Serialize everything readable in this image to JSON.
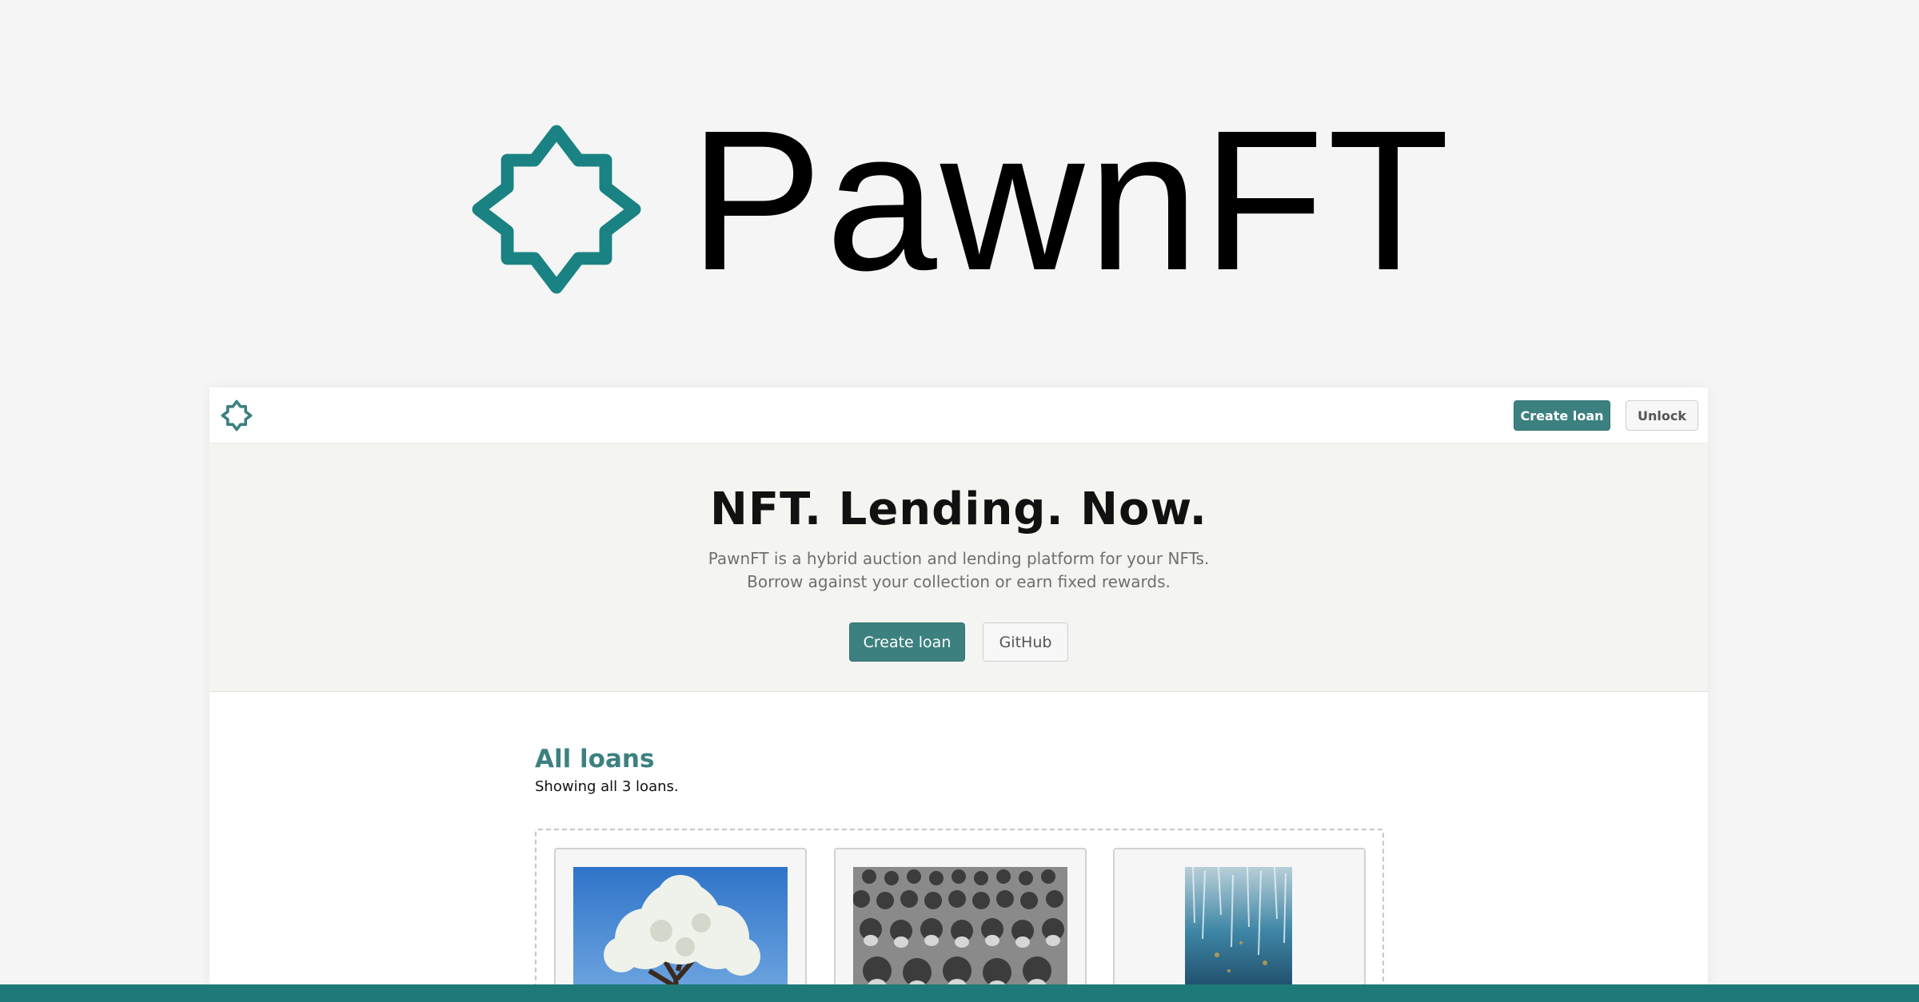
{
  "brand": {
    "name": "PawnFT",
    "logo_icon": "eight-point-star-outline-icon",
    "color": "#1a8282"
  },
  "navbar": {
    "logo_icon": "eight-point-star-outline-icon",
    "create_loan_label": "Create loan",
    "unlock_label": "Unlock"
  },
  "hero": {
    "title": "NFT. Lending. Now.",
    "description_line1": "PawnFT is a hybrid auction and lending platform for your NFTs.",
    "description_line2": "Borrow against your collection or earn fixed rewards.",
    "create_loan_label": "Create loan",
    "github_label": "GitHub"
  },
  "loans": {
    "title": "All loans",
    "count_text": "Showing all 3 loans.",
    "items": [
      {
        "image": "blossoming-tree-image"
      },
      {
        "image": "soldiers-crowd-image"
      },
      {
        "image": "blue-abstract-image"
      }
    ]
  },
  "colors": {
    "accent": "#3d8080",
    "bottom_bar": "#1e7a78"
  }
}
